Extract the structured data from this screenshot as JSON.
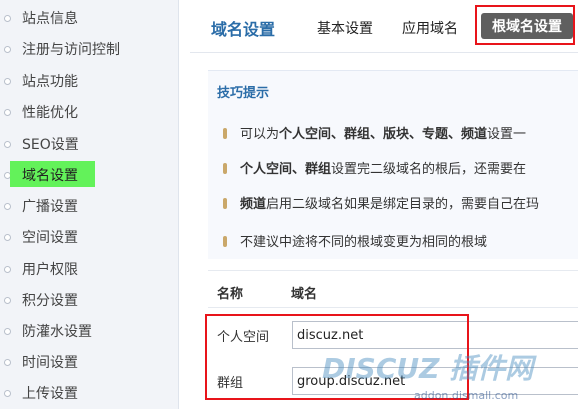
{
  "sidebar": {
    "items": [
      {
        "label": "站点信息",
        "active": false
      },
      {
        "label": "注册与访问控制",
        "active": false
      },
      {
        "label": "站点功能",
        "active": false
      },
      {
        "label": "性能优化",
        "active": false
      },
      {
        "label": "SEO设置",
        "active": false
      },
      {
        "label": "域名设置",
        "active": true
      },
      {
        "label": "广播设置",
        "active": false
      },
      {
        "label": "空间设置",
        "active": false
      },
      {
        "label": "用户权限",
        "active": false
      },
      {
        "label": "积分设置",
        "active": false
      },
      {
        "label": "防灌水设置",
        "active": false
      },
      {
        "label": "时间设置",
        "active": false
      },
      {
        "label": "上传设置",
        "active": false
      }
    ]
  },
  "header": {
    "title": "域名设置",
    "tabs": [
      {
        "label": "基本设置"
      },
      {
        "label": "应用域名"
      },
      {
        "label": "根域名设置"
      }
    ]
  },
  "tips": {
    "title": "技巧提示",
    "lines": [
      {
        "pre": "可以为",
        "bold": "个人空间、群组、版块、专题、频道",
        "post": "设置一"
      },
      {
        "pre": "",
        "bold": "个人空间、群组",
        "post": "设置完二级域名的根后，还需要在"
      },
      {
        "pre": "",
        "bold": "频道",
        "post": "启用二级域名如果是绑定目录的，需要自己在玛"
      },
      {
        "pre": "",
        "bold": "",
        "post": "不建议中途将不同的根域变更为相同的根域"
      }
    ]
  },
  "table": {
    "col_name": "名称",
    "col_domain": "域名",
    "rows": [
      {
        "label": "个人空间",
        "value": "discuz.net"
      },
      {
        "label": "群组",
        "value": "group.discuz.net"
      }
    ]
  },
  "watermark": {
    "big": "DISCUZ 插件网",
    "small": "addon.dismall.com"
  },
  "colors": {
    "accent_blue": "#2b6da8",
    "highlight_green": "#63f25a",
    "annotation_red": "#e8141a",
    "active_tab_bg": "#5f5f5f"
  }
}
